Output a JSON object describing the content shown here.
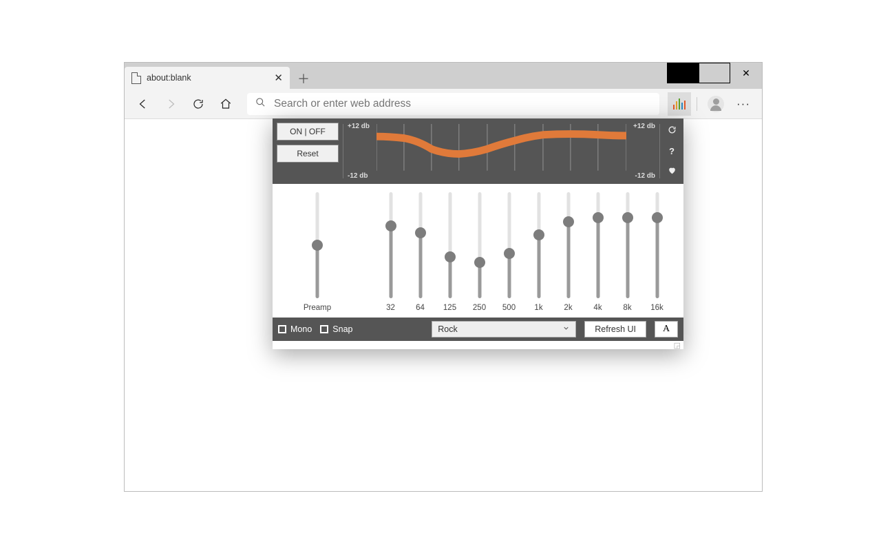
{
  "browser": {
    "tab_title": "about:blank",
    "address_placeholder": "Search or enter web address"
  },
  "eq": {
    "on_off": "ON | OFF",
    "reset": "Reset",
    "db_plus": "+12  db",
    "db_minus": "-12  db",
    "preamp_label": "Preamp",
    "preamp_pct": 50,
    "bands": [
      {
        "label": "32",
        "pct": 68
      },
      {
        "label": "64",
        "pct": 62
      },
      {
        "label": "125",
        "pct": 39
      },
      {
        "label": "250",
        "pct": 34
      },
      {
        "label": "500",
        "pct": 42
      },
      {
        "label": "1k",
        "pct": 60
      },
      {
        "label": "2k",
        "pct": 72
      },
      {
        "label": "4k",
        "pct": 76
      },
      {
        "label": "8k",
        "pct": 76
      },
      {
        "label": "16k",
        "pct": 76
      }
    ],
    "mono": "Mono",
    "snap": "Snap",
    "preset": "Rock",
    "refresh": "Refresh UI"
  }
}
